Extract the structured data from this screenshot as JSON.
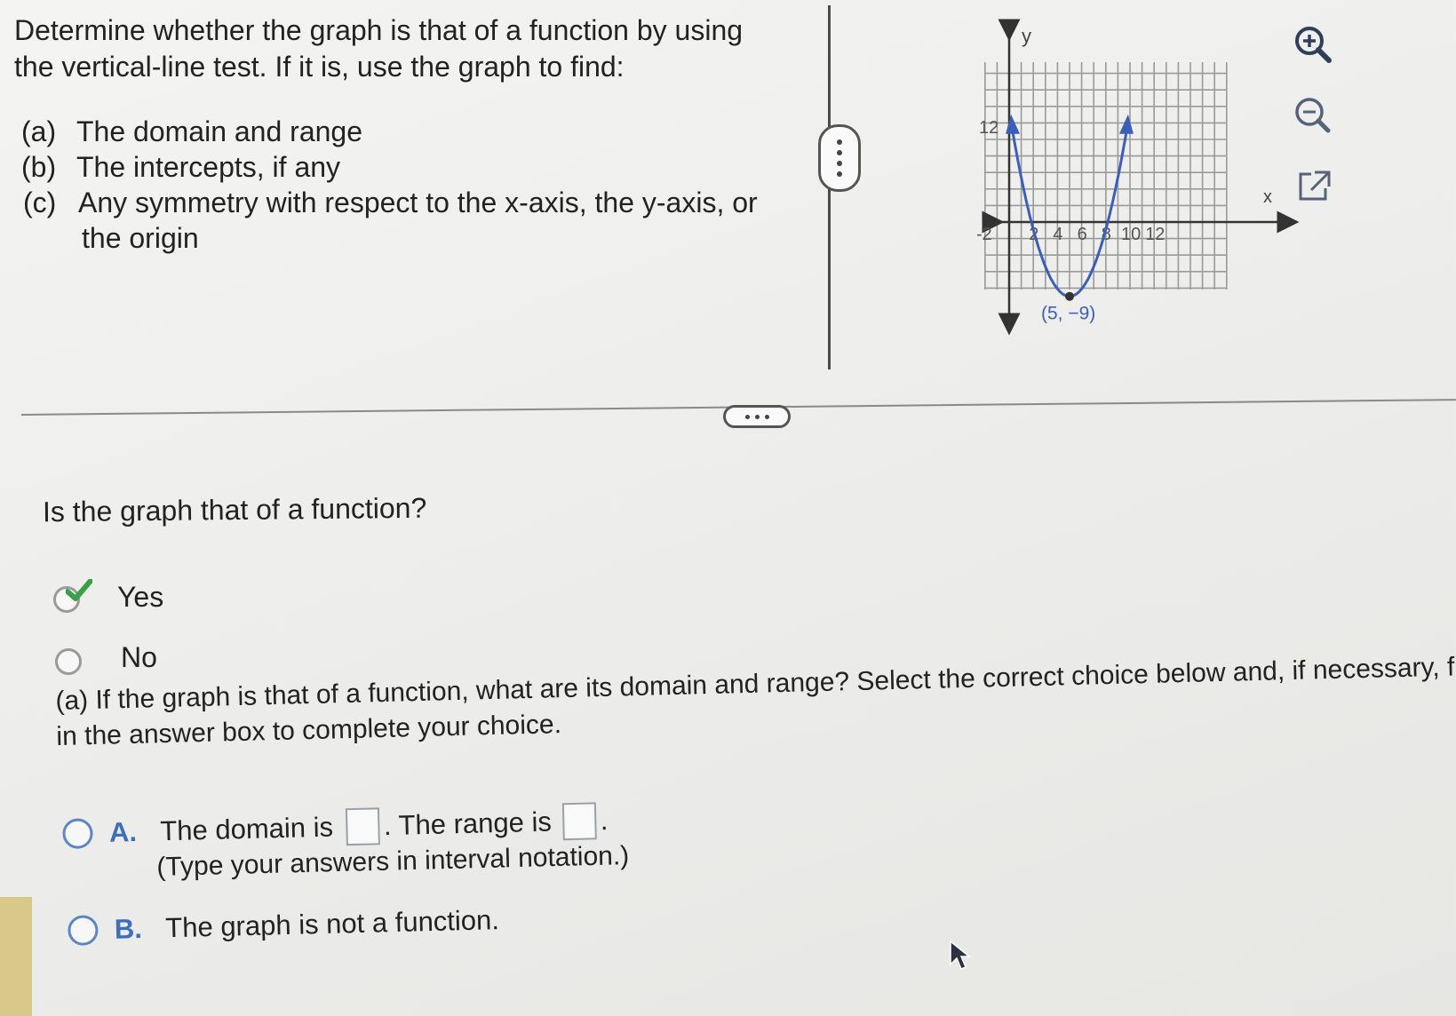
{
  "question": {
    "line1": "Determine whether the graph is that of a function by using",
    "line2": "the vertical-line test. If it is, use the graph to find:",
    "parts": [
      {
        "label": "(a)",
        "text": "The domain and range"
      },
      {
        "label": "(b)",
        "text": "The intercepts, if any"
      },
      {
        "label": "(c)",
        "text": "Any symmetry with respect to the x-axis, the y-axis, or"
      }
    ],
    "part_c_cont": "the origin"
  },
  "graph": {
    "y_axis_label": "y",
    "x_axis_label": "x",
    "y_tick_12": "12",
    "x_ticks": [
      "-2",
      "2",
      "4",
      "6",
      "8",
      "10",
      "12"
    ],
    "vertex_label": "(5, −9)",
    "vertex": [
      5,
      -9
    ],
    "curve_color": "#3b5fb8"
  },
  "tools": {
    "zoom_in_icon": "zoom-in-icon",
    "zoom_out_icon": "zoom-out-icon",
    "popout_icon": "external-link-icon"
  },
  "function_question": {
    "prompt": "Is the graph that of a function?",
    "options": [
      {
        "label": "Yes",
        "selected": true
      },
      {
        "label": "No",
        "selected": false
      }
    ]
  },
  "part_a": {
    "prompt_line1": "(a) If the graph is that of a function, what are its domain and range? Select the correct choice below and, if necessary, fill",
    "prompt_line2": "in the answer box to complete your choice.",
    "choice_a": {
      "letter": "A.",
      "text1": "The domain is",
      "text2": ". The range is",
      "text3": ".",
      "hint": "(Type your answers in interval notation.)",
      "domain_value": "",
      "range_value": ""
    },
    "choice_b": {
      "letter": "B.",
      "text": "The graph is not a function."
    }
  }
}
